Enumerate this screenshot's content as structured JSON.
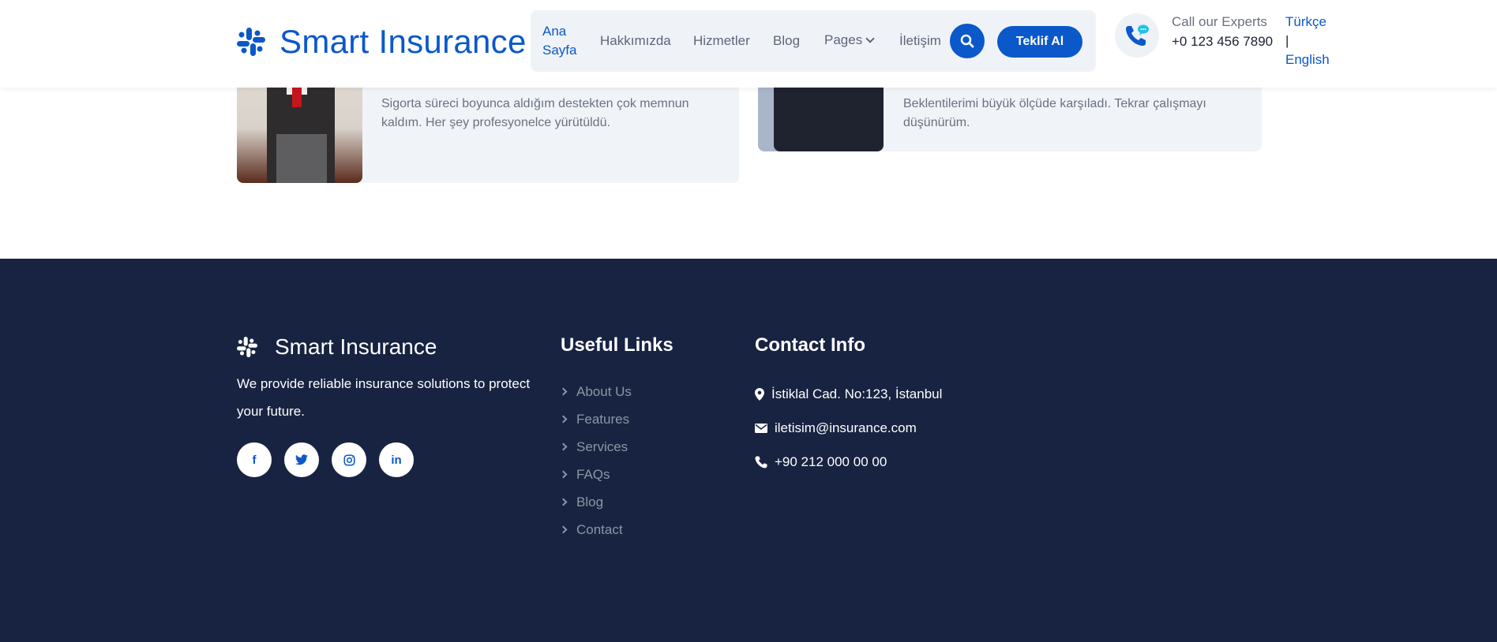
{
  "header": {
    "brand": "Smart Insurance",
    "nav": [
      {
        "label": "Ana Sayfa"
      },
      {
        "label": "Hakkımızda"
      },
      {
        "label": "Hizmetler"
      },
      {
        "label": "Blog"
      },
      {
        "label": "Pages"
      },
      {
        "label": "İletişim"
      }
    ],
    "quote_button": "Teklif Al",
    "call_label": "Call our Experts",
    "call_number": "+0 123 456 7890",
    "lang_tr": "Türkçe",
    "lang_sep": "|",
    "lang_en": "English"
  },
  "testimonials": [
    {
      "text": "Sigorta süreci boyunca aldığım destekten çok memnun kaldım. Her şey profesyonelce yürütüldü."
    },
    {
      "text": "Beklentilerimi büyük ölçüde karşıladı. Tekrar çalışmayı düşünürüm."
    }
  ],
  "footer": {
    "brand": "Smart Insurance",
    "description": "We provide reliable insurance solutions to protect your future.",
    "socials": [
      {
        "icon": "facebook-icon",
        "glyph": "f"
      },
      {
        "icon": "twitter-icon",
        "glyph": "t"
      },
      {
        "icon": "instagram-icon",
        "glyph": "ig"
      },
      {
        "icon": "linkedin-icon",
        "glyph": "in"
      }
    ],
    "useful_links_title": "Useful Links",
    "useful_links": [
      "About Us",
      "Features",
      "Services",
      "FAQs",
      "Blog",
      "Contact"
    ],
    "contact_title": "Contact Info",
    "address": "İstiklal Cad. No:123, İstanbul",
    "email": "iletisim@insurance.com",
    "phone": "+90 212 000 00 00"
  },
  "colors": {
    "brand_blue": "#0a58ca",
    "footer_bg": "#172341",
    "nav_bg": "#eff3f8"
  }
}
